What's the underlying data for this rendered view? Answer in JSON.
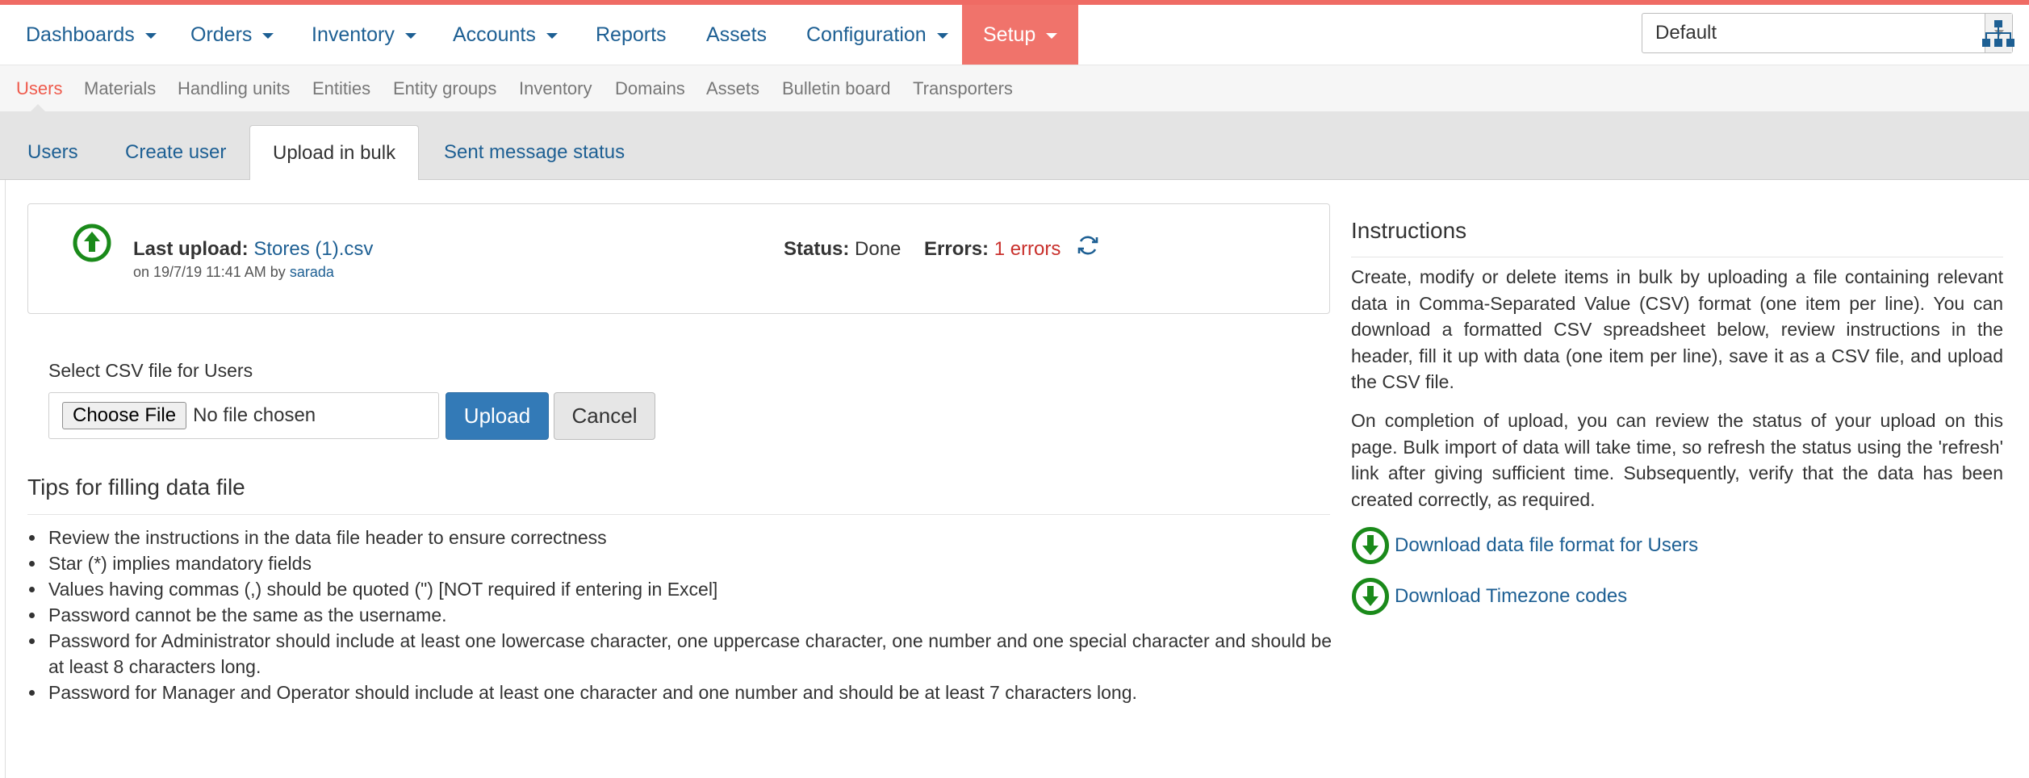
{
  "topnav": {
    "items": [
      {
        "label": "Dashboards",
        "has_caret": true
      },
      {
        "label": "Orders",
        "has_caret": true
      },
      {
        "label": "Inventory",
        "has_caret": true
      },
      {
        "label": "Accounts",
        "has_caret": true
      },
      {
        "label": "Reports",
        "has_caret": false
      },
      {
        "label": "Assets",
        "has_caret": false
      },
      {
        "label": "Configuration",
        "has_caret": true
      },
      {
        "label": "Setup",
        "has_caret": true,
        "active": true
      }
    ],
    "selector_value": "Default",
    "sitemap_icon": "sitemap-icon"
  },
  "subnav": {
    "items": [
      "Users",
      "Materials",
      "Handling units",
      "Entities",
      "Entity groups",
      "Inventory",
      "Domains",
      "Assets",
      "Bulletin board",
      "Transporters"
    ],
    "active": "Users"
  },
  "tabs": {
    "items": [
      "Users",
      "Create user",
      "Upload in bulk",
      "Sent message status"
    ],
    "active": "Upload in bulk"
  },
  "upload_status": {
    "last_upload_label": "Last upload:",
    "file_name": "Stores (1).csv",
    "on_text": "on 19/7/19 11:41 AM by",
    "user": "sarada",
    "status_label": "Status:",
    "status_value": "Done",
    "errors_label": "Errors:",
    "errors_value": "1 errors",
    "upload_icon": "upload-circle-icon",
    "refresh_icon": "refresh-icon"
  },
  "form": {
    "select_label": "Select CSV file for Users",
    "choose_file_label": "Choose File",
    "no_file_text": "No file chosen",
    "upload_button": "Upload",
    "cancel_button": "Cancel"
  },
  "tips": {
    "heading": "Tips for filling data file",
    "items": [
      "Review the instructions in the data file header to ensure correctness",
      "Star (*) implies mandatory fields",
      "Values having commas (,) should be quoted (\") [NOT required if entering in Excel]",
      "Password cannot be the same as the username.",
      "Password for Administrator should include at least one lowercase character, one uppercase character, one number and one special character and should be at least 8 characters long.",
      "Password for Manager and Operator should include at least one character and one number and should be at least 7 characters long."
    ]
  },
  "instructions": {
    "heading": "Instructions",
    "paragraph1": "Create, modify or delete items in bulk by uploading a file containing relevant data in Comma-Separated Value (CSV) format (one item per line). You can download a formatted CSV spreadsheet below, review instructions in the header, fill it up with data (one item per line), save it as a CSV file, and upload the CSV file.",
    "paragraph2": "On completion of upload, you can review the status of your upload on this page. Bulk import of data will take time, so refresh the status using the 'refresh' link after giving sufficient time. Subsequently, verify that the data has been created correctly, as required.",
    "download_format_link": "Download data file format for Users",
    "download_timezone_link": "Download Timezone codes",
    "download_icon": "download-circle-icon"
  },
  "colors": {
    "accent": "#f0736b",
    "link": "#1d5f93",
    "primary_button": "#337ab7",
    "error": "#c9302c",
    "icon_green": "#1a8a1a"
  }
}
